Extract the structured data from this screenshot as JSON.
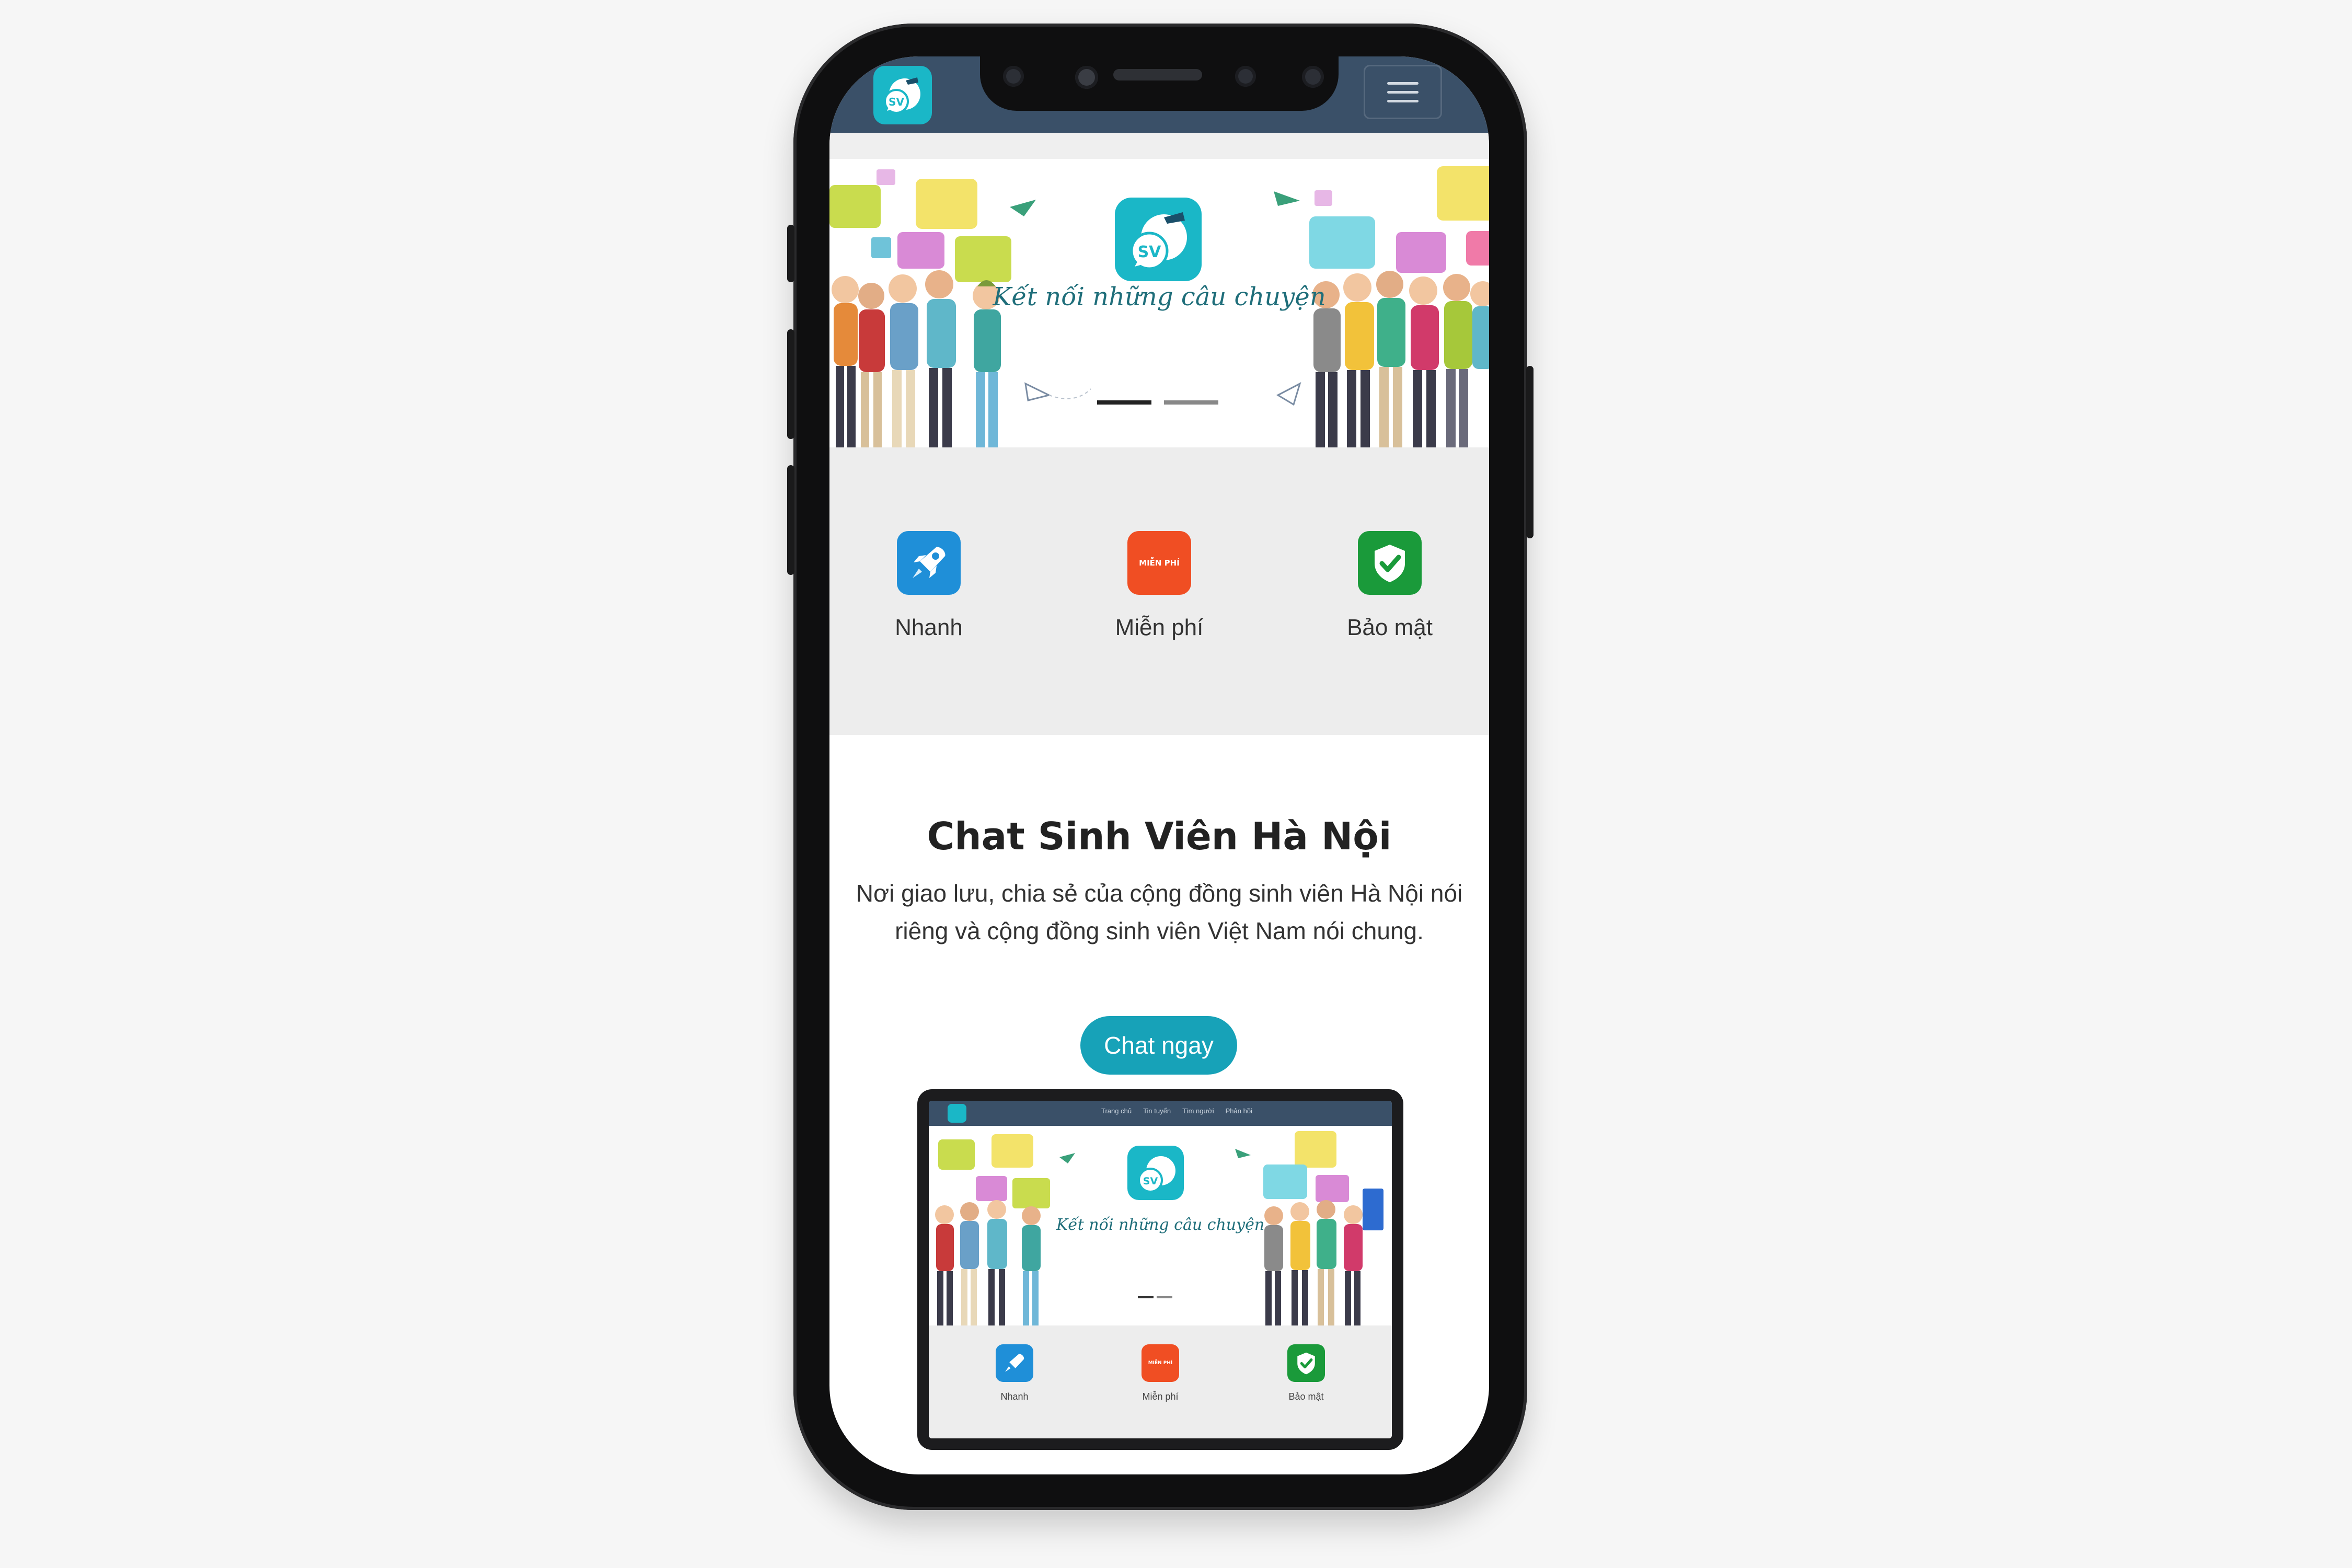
{
  "nav": {
    "logo_text": "SV",
    "menu_icon": "hamburger-icon"
  },
  "banner": {
    "tagline": "Kết nối những câu chuyện",
    "logo_text": "SV",
    "slides_active": 1,
    "slides_total": 2
  },
  "features": [
    {
      "label": "Nhanh",
      "icon": "rocket-icon",
      "color": "#1f8fd8"
    },
    {
      "label": "Miễn phí",
      "icon": "free-badge-icon",
      "badge_text": "MIỄN PHÍ",
      "color": "#f04e23"
    },
    {
      "label": "Bảo mật",
      "icon": "shield-check-icon",
      "color": "#1a9a3a"
    }
  ],
  "hero": {
    "title": "Chat Sinh Viên Hà Nội",
    "description": "Nơi giao lưu, chia sẻ của cộng đồng sinh viên Hà Nội nói riêng và cộng đồng sinh viên Việt Nam nói chung.",
    "cta_label": "Chat ngay"
  },
  "preview": {
    "nav_links": [
      "Trang chủ",
      "Tin tuyển",
      "Tìm người",
      "Phản hồi"
    ],
    "tagline": "Kết nối những câu chuyện",
    "logo_text": "SV",
    "badge_text": "MIỄN PHÍ",
    "feature_labels": [
      "Nhanh",
      "Miễn phí",
      "Bảo mật"
    ]
  },
  "colors": {
    "nav": "#3a5068",
    "accent": "#17a2b8",
    "logo": "#1ab7c7",
    "page_bg": "#f6f6f6",
    "feature_bg": "#ededed"
  }
}
